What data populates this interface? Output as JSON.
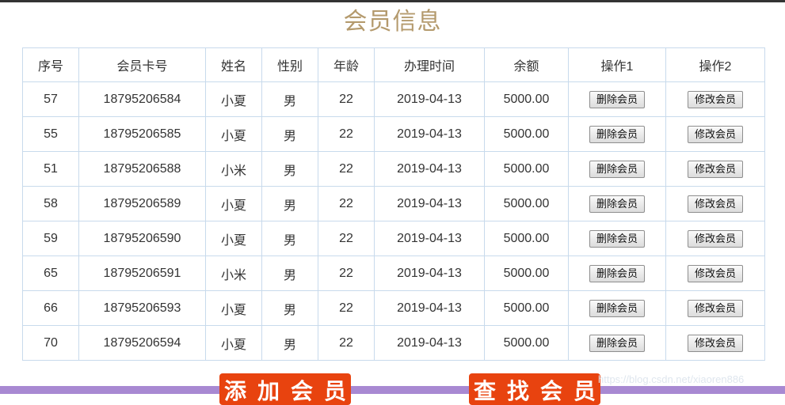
{
  "page": {
    "title": "会员信息"
  },
  "table": {
    "headers": [
      "序号",
      "会员卡号",
      "姓名",
      "性别",
      "年龄",
      "办理时间",
      "余额",
      "操作1",
      "操作2"
    ],
    "delete_label": "删除会员",
    "edit_label": "修改会员",
    "rows": [
      {
        "id": "57",
        "card": "18795206584",
        "name": "小夏",
        "gender": "男",
        "age": "22",
        "date": "2019-04-13",
        "balance": "5000.00"
      },
      {
        "id": "55",
        "card": "18795206585",
        "name": "小夏",
        "gender": "男",
        "age": "22",
        "date": "2019-04-13",
        "balance": "5000.00"
      },
      {
        "id": "51",
        "card": "18795206588",
        "name": "小米",
        "gender": "男",
        "age": "22",
        "date": "2019-04-13",
        "balance": "5000.00"
      },
      {
        "id": "58",
        "card": "18795206589",
        "name": "小夏",
        "gender": "男",
        "age": "22",
        "date": "2019-04-13",
        "balance": "5000.00"
      },
      {
        "id": "59",
        "card": "18795206590",
        "name": "小夏",
        "gender": "男",
        "age": "22",
        "date": "2019-04-13",
        "balance": "5000.00"
      },
      {
        "id": "65",
        "card": "18795206591",
        "name": "小米",
        "gender": "男",
        "age": "22",
        "date": "2019-04-13",
        "balance": "5000.00"
      },
      {
        "id": "66",
        "card": "18795206593",
        "name": "小夏",
        "gender": "男",
        "age": "22",
        "date": "2019-04-13",
        "balance": "5000.00"
      },
      {
        "id": "70",
        "card": "18795206594",
        "name": "小夏",
        "gender": "男",
        "age": "22",
        "date": "2019-04-13",
        "balance": "5000.00"
      }
    ]
  },
  "footer": {
    "add_button_label": "添加会员",
    "search_button_label": "查找会员",
    "watermark": "https://blog.csdn.net/xiaoren886"
  },
  "colors": {
    "title": "#b49a6d",
    "table_border": "#c8daec",
    "action_button": "#e8430f",
    "bottom_bar": "#a889d2"
  }
}
